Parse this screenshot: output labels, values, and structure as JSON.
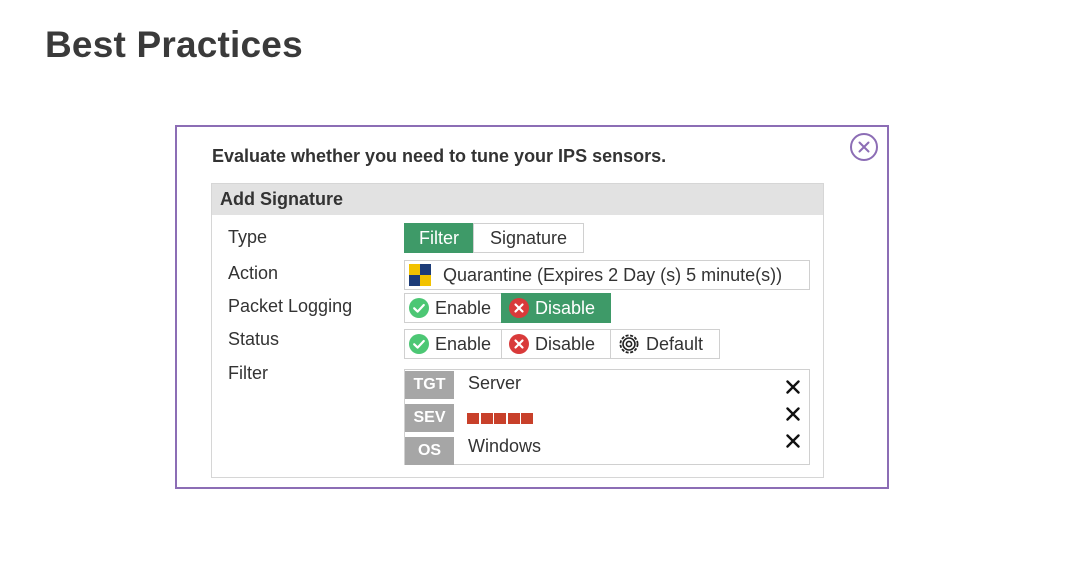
{
  "page": {
    "title": "Best Practices"
  },
  "card": {
    "heading": "Evaluate whether you need to tune your IPS sensors.",
    "close_icon": "close-circle-icon",
    "accent_color": "#8c6db5"
  },
  "panel": {
    "title": "Add Signature",
    "rows": {
      "type": {
        "label": "Type",
        "options": [
          "Filter",
          "Signature"
        ],
        "selected": "Filter"
      },
      "action": {
        "label": "Action",
        "value": "Quarantine (Expires 2 Day (s) 5 minute(s))",
        "icon": "quarantine-icon"
      },
      "packet_logging": {
        "label": "Packet Logging",
        "options": [
          "Enable",
          "Disable"
        ],
        "selected": "Disable"
      },
      "status": {
        "label": "Status",
        "options": [
          "Enable",
          "Disable",
          "Default"
        ],
        "selected": null
      },
      "filter": {
        "label": "Filter",
        "entries": [
          {
            "tag": "TGT",
            "value": "Server"
          },
          {
            "tag": "SEV",
            "value": "",
            "severity_level": 5
          },
          {
            "tag": "OS",
            "value": "Windows"
          }
        ]
      }
    }
  },
  "colors": {
    "active_green": "#3e9a68",
    "enable_green": "#4cc774",
    "disable_red": "#d93a3a",
    "severity_red": "#c8402a",
    "tag_gray": "#a6a6a6"
  }
}
